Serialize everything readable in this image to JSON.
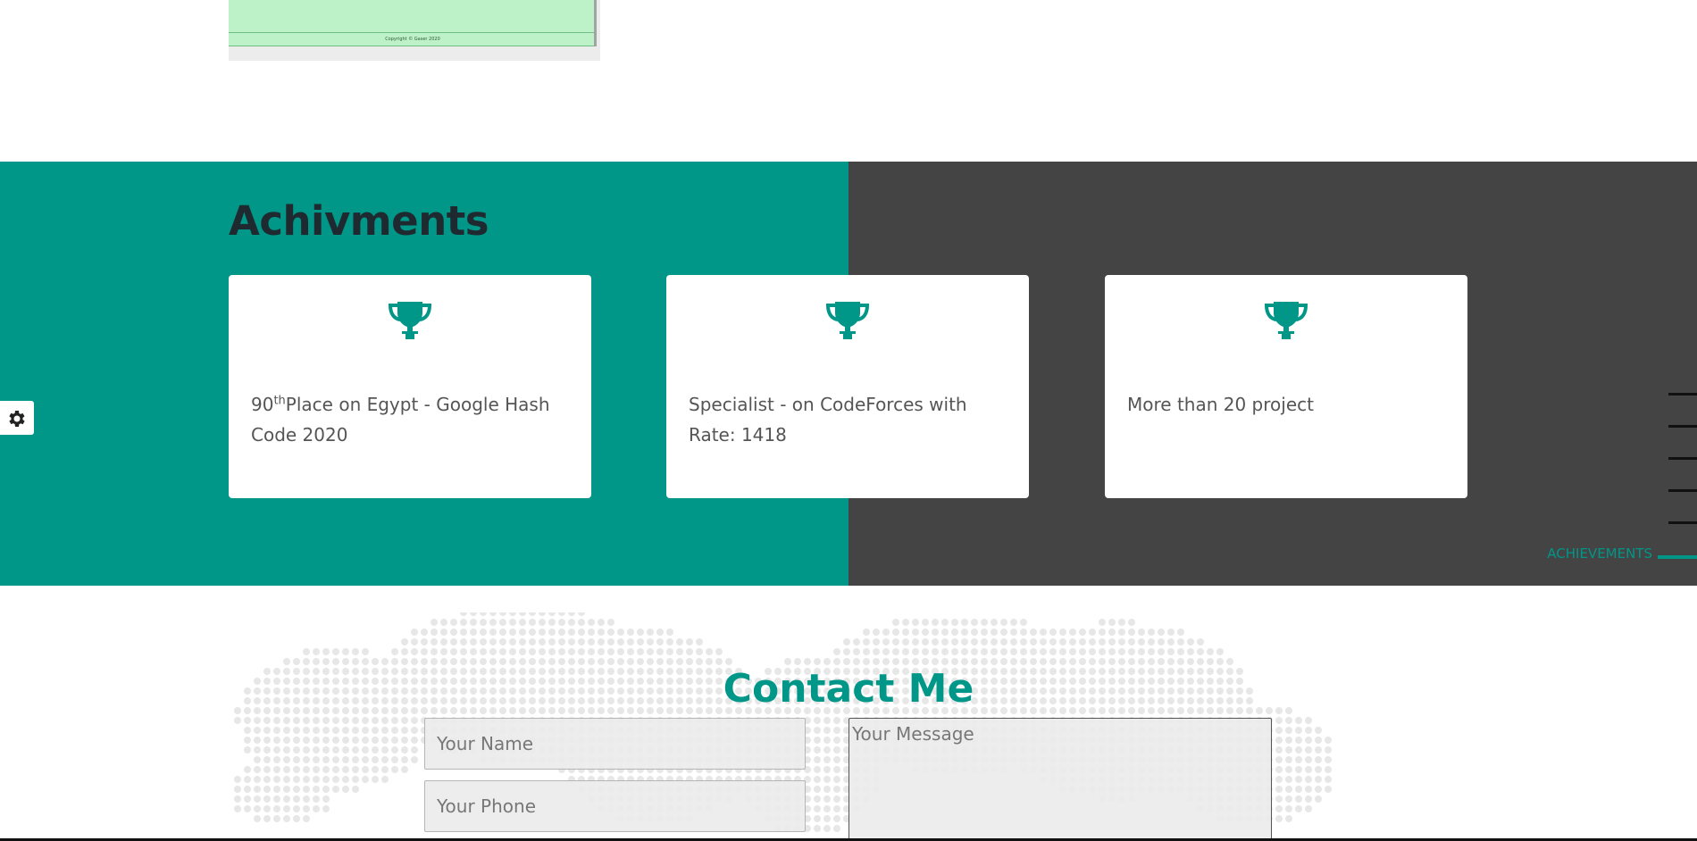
{
  "preview": {
    "copyright": "Copyright © Gaser 2020"
  },
  "achievements": {
    "title": "Achivments",
    "cards": [
      {
        "icon": "trophy-icon",
        "text_main": "90",
        "text_sup": "th",
        "text_rest": "Place on Egypt - Google Hash Code 2020"
      },
      {
        "icon": "trophy-icon",
        "text": "Specialist - on CodeForces with Rate: 1418"
      },
      {
        "icon": "trophy-icon",
        "text": "More than 20 project"
      }
    ]
  },
  "side_nav": {
    "active_label": "ACHIEVEMENTS",
    "bullet_count": 5
  },
  "settings": {
    "icon": "gear-icon"
  },
  "contact": {
    "title": "Contact Me",
    "name_placeholder": "Your Name",
    "phone_placeholder": "Your Phone",
    "message_placeholder": "Your Message"
  },
  "colors": {
    "accent": "#009688",
    "dark": "#444444",
    "title_dark": "#1f2a30"
  }
}
